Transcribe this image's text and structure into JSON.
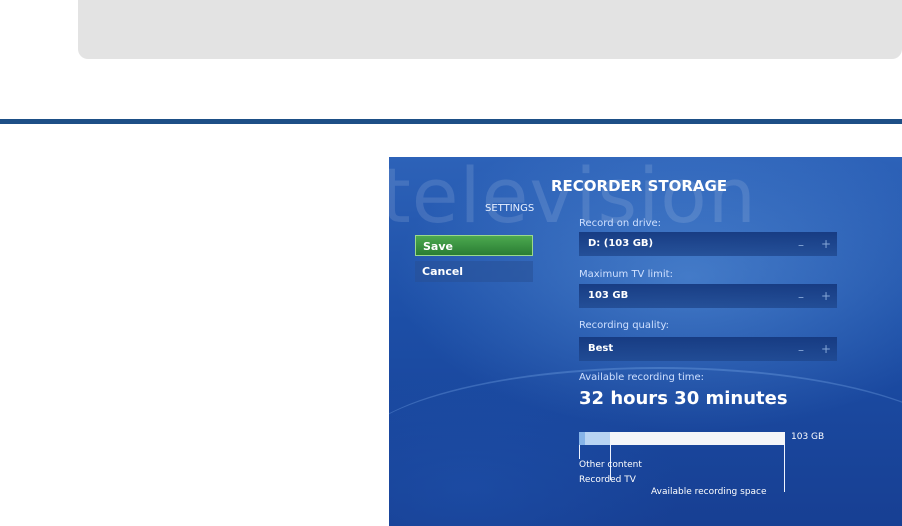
{
  "screen": {
    "watermark": "television",
    "title": "RECORDER STORAGE",
    "subtitle": "SETTINGS"
  },
  "buttons": {
    "save": "Save",
    "cancel": "Cancel"
  },
  "fields": [
    {
      "label": "Record on drive:",
      "value": "D: (103 GB)",
      "minus": "–",
      "plus": "+"
    },
    {
      "label": "Maximum TV limit:",
      "value": "103 GB",
      "minus": "–",
      "plus": "+"
    },
    {
      "label": "Recording quality:",
      "value": "Best",
      "minus": "–",
      "plus": "+"
    }
  ],
  "availability": {
    "label": "Available recording time:",
    "value": "32 hours 30 minutes"
  },
  "storage_bar": {
    "total_label": "103 GB",
    "other_content_fraction": 0.03,
    "recorded_tv_fraction": 0.15,
    "legend": {
      "other": "Other content",
      "recorded": "Recorded TV",
      "available": "Available recording space"
    }
  }
}
